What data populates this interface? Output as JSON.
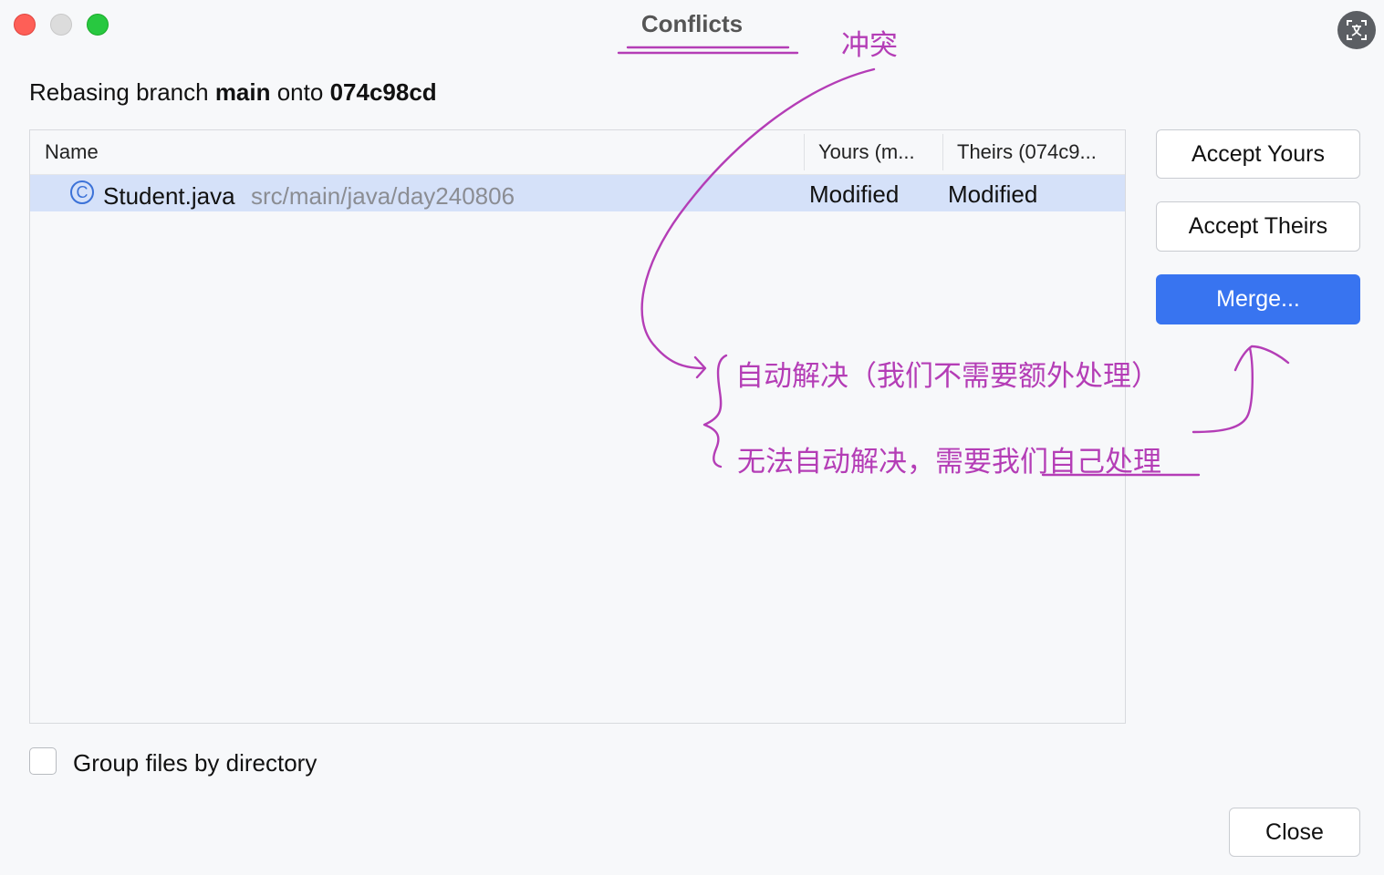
{
  "window": {
    "title": "Conflicts",
    "translate_icon": "translate-icon"
  },
  "header": {
    "prefix": "Rebasing branch ",
    "branch": "main",
    "middle": " onto ",
    "commit": "074c98cd"
  },
  "table": {
    "columns": [
      "Name",
      "Yours (m...",
      "Theirs (074c9..."
    ],
    "rows": [
      {
        "icon": "class-icon",
        "icon_glyph": "C",
        "name": "Student.java",
        "path": "src/main/java/day240806",
        "yours": "Modified",
        "theirs": "Modified"
      }
    ]
  },
  "actions": {
    "accept_yours": "Accept Yours",
    "accept_theirs": "Accept Theirs",
    "merge": "Merge..."
  },
  "options": {
    "group_by_directory": "Group files by directory",
    "group_by_directory_checked": false
  },
  "footer": {
    "close": "Close"
  },
  "annotations": {
    "conflict": "冲突",
    "auto_resolve": "自动解决（我们不需要额外处理）",
    "manual_resolve": "无法自动解决，需要我们自己处理",
    "color": "#b43db6"
  },
  "colors": {
    "accent": "#3874f0",
    "selection": "#d5e1f9",
    "background": "#f7f8fa"
  }
}
